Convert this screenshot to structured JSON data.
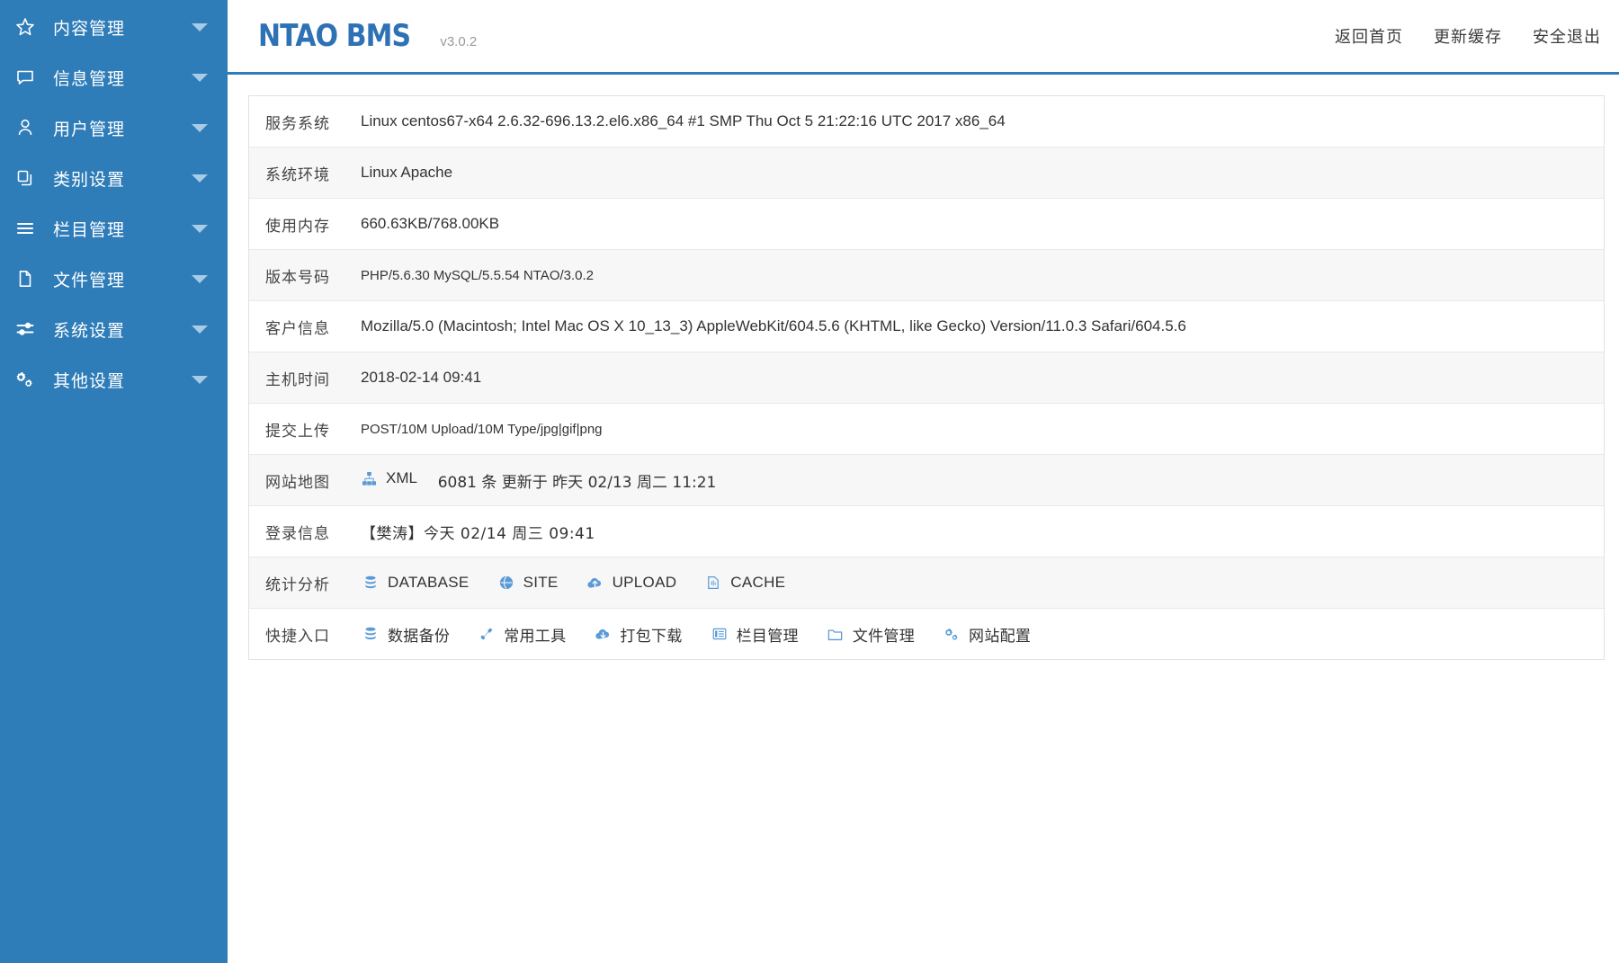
{
  "sidebar": {
    "items": [
      {
        "label": "内容管理",
        "icon": "star-icon"
      },
      {
        "label": "信息管理",
        "icon": "comment-icon"
      },
      {
        "label": "用户管理",
        "icon": "user-icon"
      },
      {
        "label": "类别设置",
        "icon": "copy-icon"
      },
      {
        "label": "栏目管理",
        "icon": "list-icon"
      },
      {
        "label": "文件管理",
        "icon": "file-icon"
      },
      {
        "label": "系统设置",
        "icon": "sliders-icon"
      },
      {
        "label": "其他设置",
        "icon": "gears-icon"
      }
    ]
  },
  "header": {
    "brand": "NTAO BMS",
    "version": "v3.0.2",
    "links": [
      {
        "label": "返回首页"
      },
      {
        "label": "更新缓存"
      },
      {
        "label": "安全退出"
      }
    ]
  },
  "info_rows": [
    {
      "label": "服务系统",
      "value": "Linux centos67-x64 2.6.32-696.13.2.el6.x86_64 #1 SMP Thu Oct 5 21:22:16 UTC 2017 x86_64"
    },
    {
      "label": "系统环境",
      "value": "Linux Apache"
    },
    {
      "label": "使用内存",
      "value": "660.63KB/768.00KB"
    },
    {
      "label": "版本号码",
      "value": "PHP/5.6.30 MySQL/5.5.54 NTAO/3.0.2"
    },
    {
      "label": "客户信息",
      "value": "Mozilla/5.0 (Macintosh; Intel Mac OS X 10_13_3) AppleWebKit/604.5.6 (KHTML, like Gecko) Version/11.0.3 Safari/604.5.6"
    },
    {
      "label": "主机时间",
      "value": "2018-02-14 09:41"
    },
    {
      "label": "提交上传",
      "value": "POST/10M Upload/10M Type/jpg|gif|png"
    }
  ],
  "sitemap": {
    "label": "网站地图",
    "icon": "sitemap-icon",
    "link_text": "XML",
    "detail": "6081 条 更新于 昨天 02/13 周二 11:21"
  },
  "login": {
    "label": "登录信息",
    "value": "【樊涛】今天 02/14 周三 09:41"
  },
  "stats": {
    "label": "统计分析",
    "items": [
      {
        "label": "DATABASE",
        "icon": "database-icon"
      },
      {
        "label": "SITE",
        "icon": "globe-icon"
      },
      {
        "label": "UPLOAD",
        "icon": "cloud-upload-icon"
      },
      {
        "label": "CACHE",
        "icon": "cache-file-icon"
      }
    ]
  },
  "shortcuts": {
    "label": "快捷入口",
    "items": [
      {
        "label": "数据备份",
        "icon": "database-icon"
      },
      {
        "label": "常用工具",
        "icon": "wrench-icon"
      },
      {
        "label": "打包下载",
        "icon": "cloud-download-icon"
      },
      {
        "label": "栏目管理",
        "icon": "columns-icon"
      },
      {
        "label": "文件管理",
        "icon": "folder-icon"
      },
      {
        "label": "网站配置",
        "icon": "gears-icon"
      }
    ]
  },
  "colors": {
    "sidebar_bg": "#2e7cb8",
    "brand_blue": "#2e71b4",
    "icon_blue": "#5b9bd5",
    "row_alt": "#f7f7f7",
    "border": "#e2e2e2"
  }
}
